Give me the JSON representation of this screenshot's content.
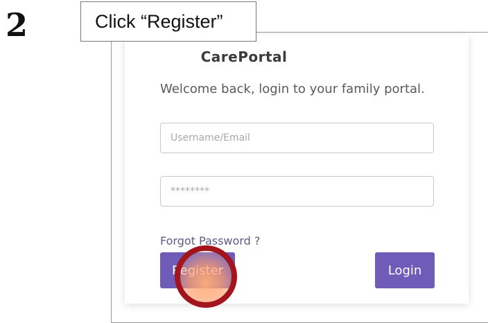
{
  "step": {
    "number": "2",
    "instruction": "Click “Register”"
  },
  "portal": {
    "title": "CarePortal",
    "subtitle": "Welcome back, login to your family portal.",
    "username_placeholder": "Username/Email",
    "password_placeholder": "********",
    "forgot_password": "Forgot Password ?",
    "register_label": "Register",
    "login_label": "Login"
  },
  "colors": {
    "button": "#6f5cb8",
    "highlight_ring": "#a3141c",
    "highlight_fill": "#ffb078"
  }
}
